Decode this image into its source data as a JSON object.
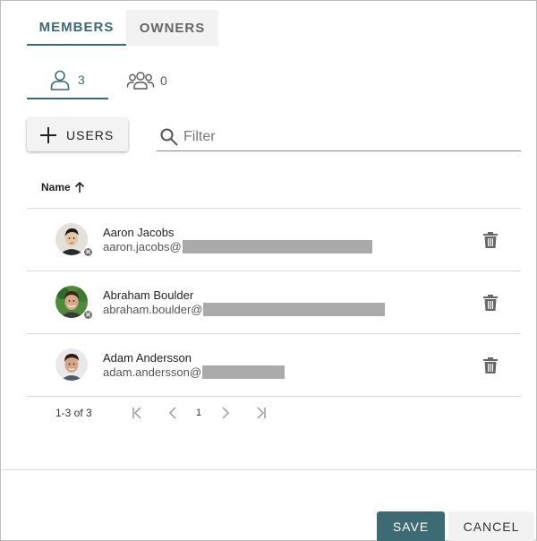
{
  "tabs": {
    "members_label": "MEMBERS",
    "owners_label": "OWNERS",
    "active": "MEMBERS"
  },
  "subtabs": {
    "users_count": "3",
    "groups_count": "0"
  },
  "toolbar": {
    "add_users_label": "USERS",
    "filter_placeholder": "Filter",
    "filter_value": ""
  },
  "table": {
    "column_name": "Name",
    "sort": "ascending",
    "rows": [
      {
        "name": "Aaron Jacobs",
        "email_prefix": "aaron.jacobs@",
        "removable_badge": true
      },
      {
        "name": "Abraham Boulder",
        "email_prefix": "abraham.boulder@",
        "removable_badge": true
      },
      {
        "name": "Adam Andersson",
        "email_prefix": "adam.andersson@",
        "removable_badge": false
      }
    ]
  },
  "pagination": {
    "range": "1-3 of 3",
    "page": "1"
  },
  "actions": {
    "save_label": "SAVE",
    "cancel_label": "CANCEL"
  },
  "colors": {
    "accent": "#3c6b73",
    "redaction": "#aaaaaa"
  }
}
